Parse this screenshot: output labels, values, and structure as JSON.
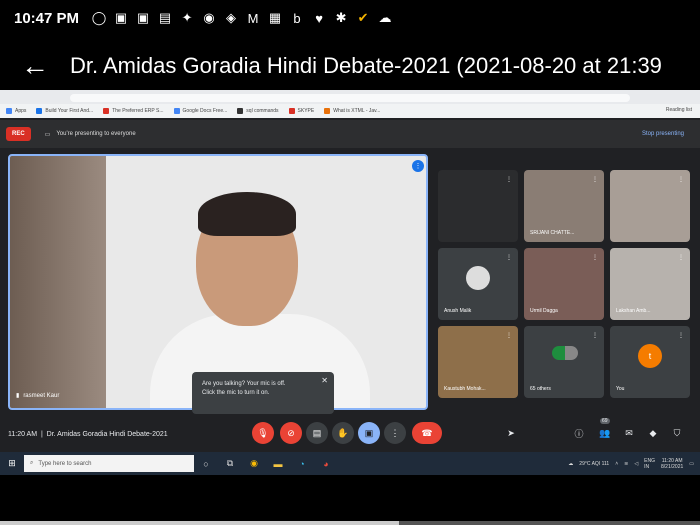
{
  "status_bar": {
    "time": "10:47 PM"
  },
  "video": {
    "title": "Dr. Amidas Goradia Hindi Debate-2021 (2021-08-20 at 21:39",
    "progress": 0.57
  },
  "browser": {
    "bookmarks": [
      {
        "label": "Apps",
        "color": "#4285f4"
      },
      {
        "label": "Build Your First And...",
        "color": "#1a73e8"
      },
      {
        "label": "The Preferred ERP S...",
        "color": "#d93025"
      },
      {
        "label": "Google Docs Free...",
        "color": "#4285f4"
      },
      {
        "label": "sql commands",
        "color": "#333333"
      },
      {
        "label": "SKYPE",
        "color": "#d93025"
      },
      {
        "label": "What is XTML - Jav...",
        "color": "#e8710a"
      }
    ],
    "reading_list": "Reading list"
  },
  "meet": {
    "rec_label": "REC",
    "presenting_text": "You're presenting to everyone",
    "stop_presenting": "Stop presenting",
    "main_speaker": "rasmeet Kaur",
    "tooltip": {
      "line1": "Are you talking? Your mic is off.",
      "line2": "Click the mic to turn it on."
    },
    "tiles": [
      {
        "name": "",
        "bg": "#2b2c2e"
      },
      {
        "name": "SRIJANI CHATTE...",
        "bg": "#8a7d74"
      },
      {
        "name": "",
        "bg": "#a89e96"
      },
      {
        "name": "Anush Malik",
        "bg": "#3c4043"
      },
      {
        "name": "Urmil Dagga",
        "bg": "#7a5d57"
      },
      {
        "name": "Lakshan Amb...",
        "bg": "#b7b2ad"
      },
      {
        "name": "Kaustubh Mohak...",
        "bg": "#8e6f4a"
      },
      {
        "name": "65 others",
        "bg": "#3c4043"
      },
      {
        "name": "You",
        "bg": "#3c4043"
      }
    ],
    "meeting_time": "11:20 AM",
    "meeting_title": "Dr. Amidas Goradia Hindi Debate-2021",
    "badge_count": "69"
  },
  "taskbar": {
    "search_placeholder": "Type here to search",
    "weather": "29°C AQI 111",
    "lang": "ENG",
    "region": "IN",
    "time": "11:20 AM",
    "date": "8/21/2021"
  }
}
